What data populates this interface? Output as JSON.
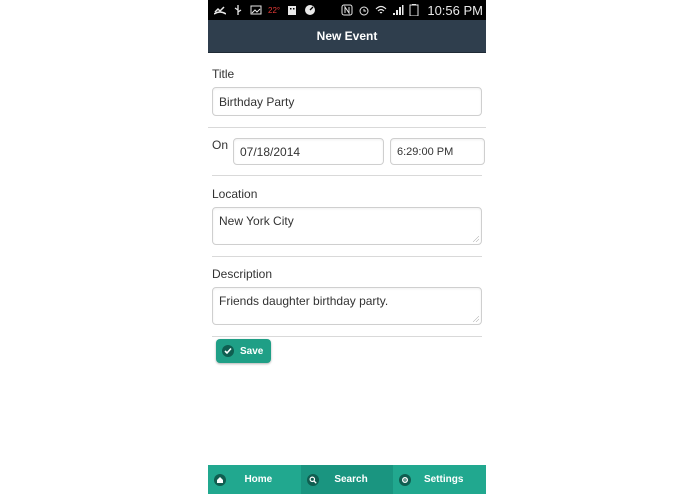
{
  "status_bar": {
    "temperature": "22°",
    "battery": "12",
    "time": "10:56 PM"
  },
  "header": {
    "title": "New Event"
  },
  "form": {
    "title_label": "Title",
    "title_value": "Birthday Party",
    "on_label": "On",
    "date_value": "07/18/2014",
    "time_value": "6:29:00 PM",
    "location_label": "Location",
    "location_value": "New York City",
    "description_label": "Description",
    "description_value": "Friends daughter birthday party.",
    "save_label": "Save"
  },
  "tabs": [
    {
      "label": "Home",
      "icon": "home-icon"
    },
    {
      "label": "Search",
      "icon": "search-icon"
    },
    {
      "label": "Settings",
      "icon": "gear-icon"
    }
  ],
  "colors": {
    "header_bg": "#2f3e4d",
    "accent": "#21a88f",
    "active_tab": "#1a9580"
  }
}
